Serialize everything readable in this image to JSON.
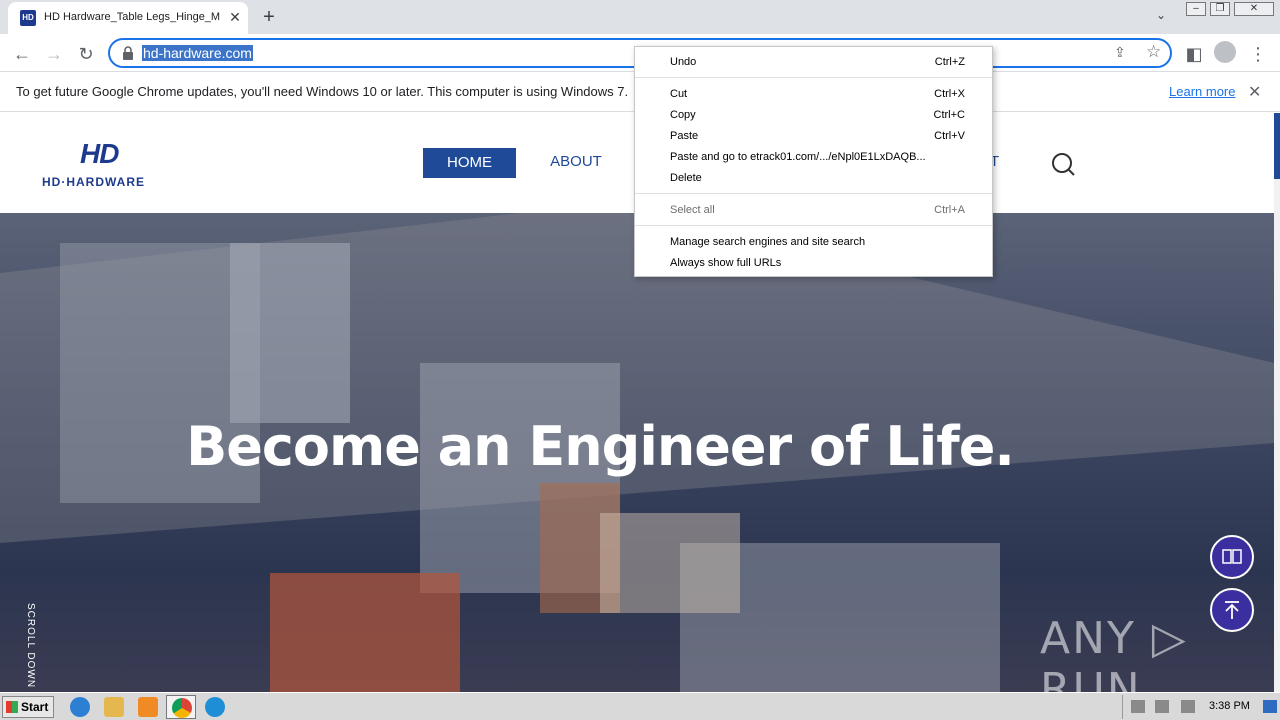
{
  "browser": {
    "tab": {
      "title": "HD Hardware_Table Legs_Hinge_Metal",
      "favicon_text": "HD"
    },
    "new_tab_label": "+",
    "address_bar": {
      "url": "hd-hardware.com"
    },
    "icons": [
      "back-arrow",
      "forward-arrow",
      "reload",
      "lock",
      "share",
      "star",
      "side-panel",
      "profile",
      "kebab-menu"
    ]
  },
  "infobar": {
    "message": "To get future Google Chrome updates, you'll need Windows 10 or later. This computer is using Windows 7.",
    "link": "Learn more",
    "close": "✕"
  },
  "site": {
    "logo": {
      "mark": "HD",
      "text": "HD·HARDWARE"
    },
    "nav": {
      "home": "HOME",
      "about": "ABOUT",
      "contact_fragment": "T"
    },
    "hero": {
      "tagline": "Become an Engineer of Life.",
      "scroll_hint": "SCROLL DOWN"
    },
    "colors": {
      "brand": "#1f4a97",
      "float_button": "#3b2fa0"
    }
  },
  "context_menu": {
    "items": [
      {
        "label": "Undo",
        "shortcut": "Ctrl+Z",
        "enabled": true
      },
      {
        "label": "Cut",
        "shortcut": "Ctrl+X",
        "enabled": true
      },
      {
        "label": "Copy",
        "shortcut": "Ctrl+C",
        "enabled": true
      },
      {
        "label": "Paste",
        "shortcut": "Ctrl+V",
        "enabled": true
      },
      {
        "label": "Paste and go to etrack01.com/.../eNpl0E1LxDAQB...",
        "shortcut": "",
        "enabled": true
      },
      {
        "label": "Delete",
        "shortcut": "",
        "enabled": true
      },
      {
        "label": "Select all",
        "shortcut": "Ctrl+A",
        "enabled": false
      },
      {
        "label": "Manage search engines and site search",
        "shortcut": "",
        "enabled": true
      },
      {
        "label": "Always show full URLs",
        "shortcut": "",
        "enabled": true
      }
    ]
  },
  "watermark": {
    "text": "ANY ▷ RUN"
  },
  "taskbar": {
    "start_label": "Start",
    "clock": "3:38 PM",
    "pinned": [
      "internet-explorer",
      "file-explorer",
      "media-player",
      "chrome",
      "edge"
    ]
  }
}
